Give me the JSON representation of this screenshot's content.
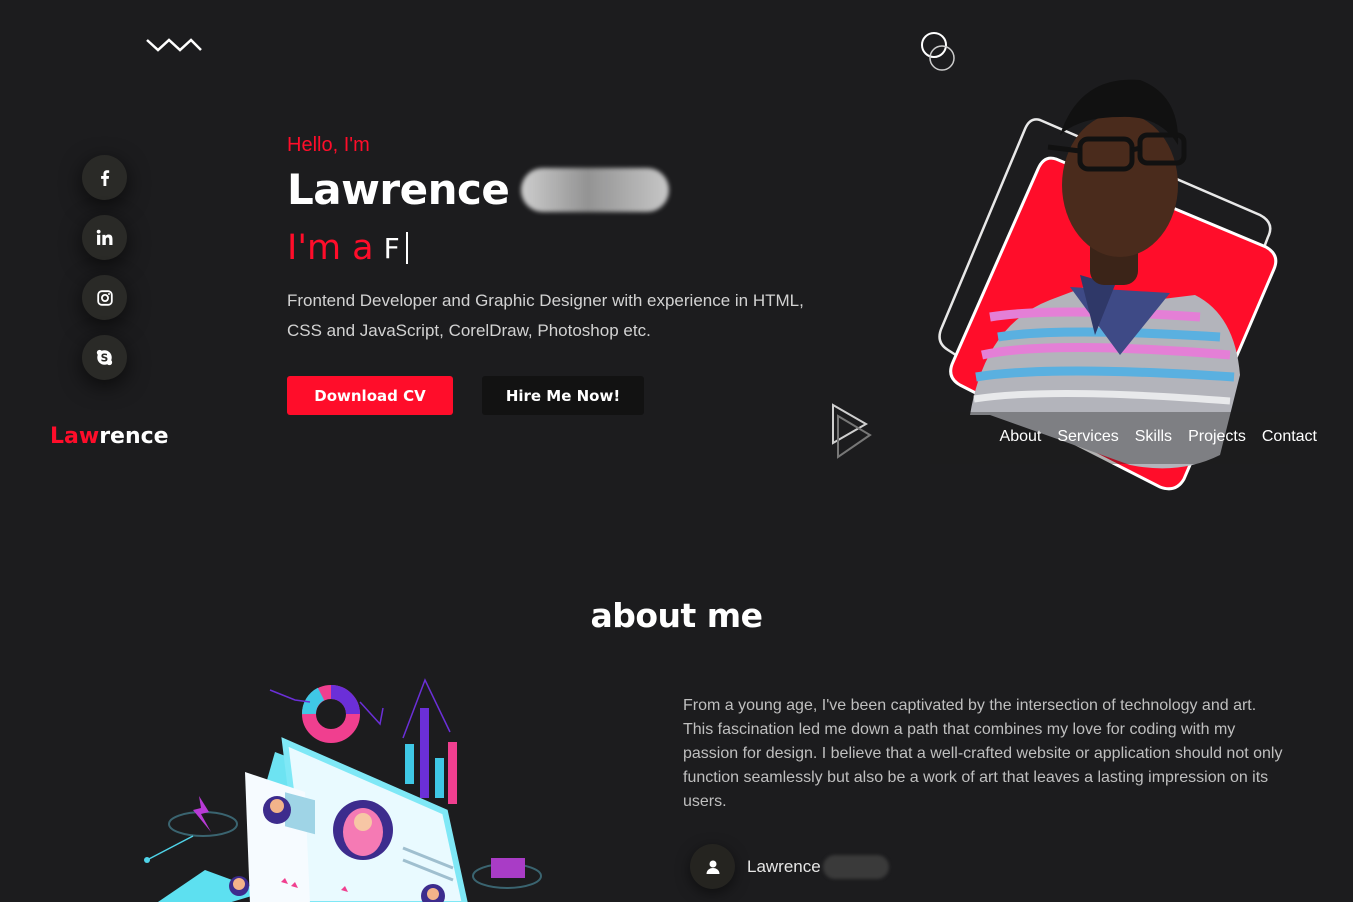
{
  "decorations": {
    "zigzag": "zigzag-shape",
    "circles": "double-circle-shape",
    "play": "play-triangle-shape"
  },
  "social": [
    {
      "name": "facebook-icon",
      "glyph": "f"
    },
    {
      "name": "linkedin-icon",
      "glyph": "in"
    },
    {
      "name": "instagram-icon",
      "glyph": "instagram"
    },
    {
      "name": "skype-icon",
      "glyph": "S"
    }
  ],
  "hero": {
    "greeting": "Hello, I'm",
    "name": "Lawrence",
    "role_prefix": "I'm a",
    "role_typed": "F",
    "bio": "Frontend Developer and Graphic Designer with experience in HTML, CSS and JavaScript, CorelDraw, Photoshop etc.",
    "download_cv": "Download CV",
    "hire_me": "Hire Me Now!"
  },
  "nav": {
    "logo_accent": "Law",
    "logo_rest": "rence",
    "links": [
      "About",
      "Services",
      "Skills",
      "Projects",
      "Contact"
    ]
  },
  "about": {
    "title": "about me",
    "text": "From a young age, I've been captivated by the intersection of technology and art. This fascination led me down a path that combines my love for coding with my passion for design. I believe that a well-crafted website or application should not only function seamlessly but also be a work of art that leaves a lasting impression on its users.",
    "profile_name": "Lawrence"
  },
  "colors": {
    "accent": "#ff0d2a",
    "background": "#1c1c1e",
    "dark_button": "#121212"
  }
}
